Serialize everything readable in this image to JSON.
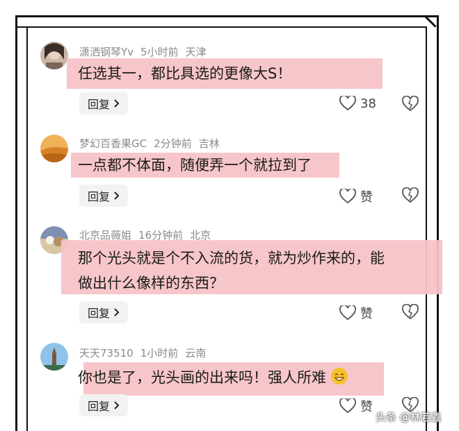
{
  "comments": [
    {
      "username": "潇洒钢琴Yv",
      "time": "5小时前",
      "location": "天津",
      "text_lines": [
        "任选其一，都比具选的更像大S！"
      ],
      "reply_label": "回复",
      "like_label": "38"
    },
    {
      "username": "梦幻百香果GC",
      "time": "2分钟前",
      "location": "吉林",
      "text_lines": [
        "一点都不体面，随便弄一个就拉到了"
      ],
      "reply_label": "回复",
      "like_label": "赞"
    },
    {
      "username": "北京品薇姐",
      "time": "16分钟前",
      "location": "北京",
      "text_lines": [
        "那个光头就是个不入流的货，就为炒作来的，能",
        "做出什么像样的东西？"
      ],
      "reply_label": "回复",
      "like_label": "赞"
    },
    {
      "username": "天天73510",
      "time": "1小时前",
      "location": "云南",
      "text_lines": [
        "你也是了，光头画的出来吗！强人所难"
      ],
      "reply_label": "回复",
      "like_label": "赞"
    }
  ],
  "watermark": "头条 @林若鑫",
  "icons": {
    "like": "heart-outline-icon",
    "dislike": "broken-heart-icon",
    "reply_arrow": "chevron-right-icon",
    "emoji": "grinning-face-emoji"
  },
  "colors": {
    "highlight": "#f7c3c7",
    "meta_text": "#8a8a8a",
    "reply_bg": "#f2f2f2"
  }
}
